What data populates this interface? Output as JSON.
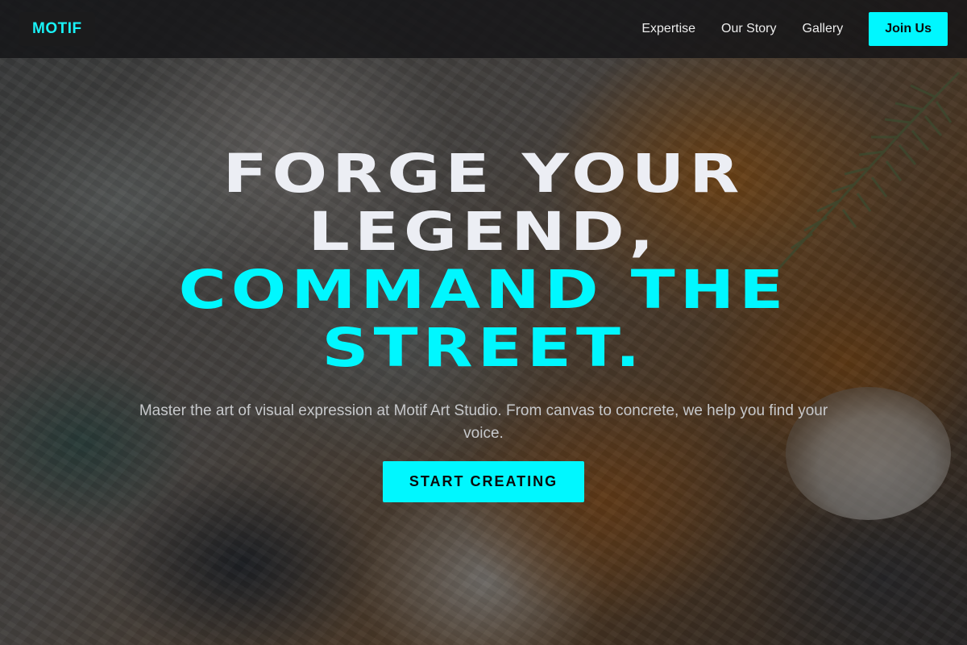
{
  "nav": {
    "logo": "MOTIF",
    "links": [
      "Expertise",
      "Our Story",
      "Gallery"
    ],
    "cta_label": "Join Us"
  },
  "hero": {
    "headline_line1": "FORGE YOUR",
    "headline_line2": "LEGEND,",
    "headline_line3": "COMMAND THE",
    "headline_line4": "STREET.",
    "subtext": "Master the art of visual expression at Motif Art Studio. From canvas to concrete, we help you find your voice.",
    "cta_label": "START CREATING"
  },
  "colors": {
    "accent": "#00f7ff",
    "headline_white": "#eceef4",
    "nav_bg": "#141416"
  },
  "background": {
    "image": "painting-palette-background"
  }
}
